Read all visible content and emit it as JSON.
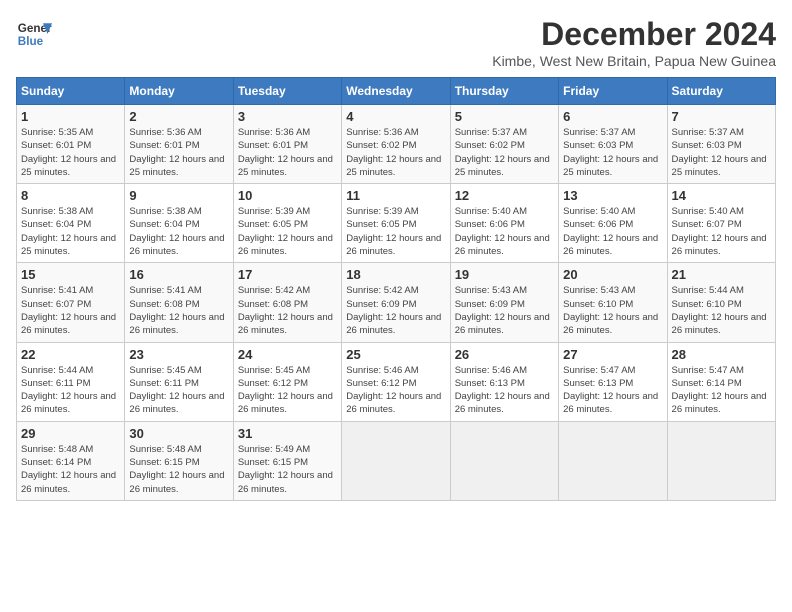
{
  "header": {
    "logo_line1": "General",
    "logo_line2": "Blue",
    "month_title": "December 2024",
    "subtitle": "Kimbe, West New Britain, Papua New Guinea"
  },
  "weekdays": [
    "Sunday",
    "Monday",
    "Tuesday",
    "Wednesday",
    "Thursday",
    "Friday",
    "Saturday"
  ],
  "weeks": [
    [
      {
        "day": "1",
        "sunrise": "5:35 AM",
        "sunset": "6:01 PM",
        "daylight": "12 hours and 25 minutes."
      },
      {
        "day": "2",
        "sunrise": "5:36 AM",
        "sunset": "6:01 PM",
        "daylight": "12 hours and 25 minutes."
      },
      {
        "day": "3",
        "sunrise": "5:36 AM",
        "sunset": "6:01 PM",
        "daylight": "12 hours and 25 minutes."
      },
      {
        "day": "4",
        "sunrise": "5:36 AM",
        "sunset": "6:02 PM",
        "daylight": "12 hours and 25 minutes."
      },
      {
        "day": "5",
        "sunrise": "5:37 AM",
        "sunset": "6:02 PM",
        "daylight": "12 hours and 25 minutes."
      },
      {
        "day": "6",
        "sunrise": "5:37 AM",
        "sunset": "6:03 PM",
        "daylight": "12 hours and 25 minutes."
      },
      {
        "day": "7",
        "sunrise": "5:37 AM",
        "sunset": "6:03 PM",
        "daylight": "12 hours and 25 minutes."
      }
    ],
    [
      {
        "day": "8",
        "sunrise": "5:38 AM",
        "sunset": "6:04 PM",
        "daylight": "12 hours and 25 minutes."
      },
      {
        "day": "9",
        "sunrise": "5:38 AM",
        "sunset": "6:04 PM",
        "daylight": "12 hours and 26 minutes."
      },
      {
        "day": "10",
        "sunrise": "5:39 AM",
        "sunset": "6:05 PM",
        "daylight": "12 hours and 26 minutes."
      },
      {
        "day": "11",
        "sunrise": "5:39 AM",
        "sunset": "6:05 PM",
        "daylight": "12 hours and 26 minutes."
      },
      {
        "day": "12",
        "sunrise": "5:40 AM",
        "sunset": "6:06 PM",
        "daylight": "12 hours and 26 minutes."
      },
      {
        "day": "13",
        "sunrise": "5:40 AM",
        "sunset": "6:06 PM",
        "daylight": "12 hours and 26 minutes."
      },
      {
        "day": "14",
        "sunrise": "5:40 AM",
        "sunset": "6:07 PM",
        "daylight": "12 hours and 26 minutes."
      }
    ],
    [
      {
        "day": "15",
        "sunrise": "5:41 AM",
        "sunset": "6:07 PM",
        "daylight": "12 hours and 26 minutes."
      },
      {
        "day": "16",
        "sunrise": "5:41 AM",
        "sunset": "6:08 PM",
        "daylight": "12 hours and 26 minutes."
      },
      {
        "day": "17",
        "sunrise": "5:42 AM",
        "sunset": "6:08 PM",
        "daylight": "12 hours and 26 minutes."
      },
      {
        "day": "18",
        "sunrise": "5:42 AM",
        "sunset": "6:09 PM",
        "daylight": "12 hours and 26 minutes."
      },
      {
        "day": "19",
        "sunrise": "5:43 AM",
        "sunset": "6:09 PM",
        "daylight": "12 hours and 26 minutes."
      },
      {
        "day": "20",
        "sunrise": "5:43 AM",
        "sunset": "6:10 PM",
        "daylight": "12 hours and 26 minutes."
      },
      {
        "day": "21",
        "sunrise": "5:44 AM",
        "sunset": "6:10 PM",
        "daylight": "12 hours and 26 minutes."
      }
    ],
    [
      {
        "day": "22",
        "sunrise": "5:44 AM",
        "sunset": "6:11 PM",
        "daylight": "12 hours and 26 minutes."
      },
      {
        "day": "23",
        "sunrise": "5:45 AM",
        "sunset": "6:11 PM",
        "daylight": "12 hours and 26 minutes."
      },
      {
        "day": "24",
        "sunrise": "5:45 AM",
        "sunset": "6:12 PM",
        "daylight": "12 hours and 26 minutes."
      },
      {
        "day": "25",
        "sunrise": "5:46 AM",
        "sunset": "6:12 PM",
        "daylight": "12 hours and 26 minutes."
      },
      {
        "day": "26",
        "sunrise": "5:46 AM",
        "sunset": "6:13 PM",
        "daylight": "12 hours and 26 minutes."
      },
      {
        "day": "27",
        "sunrise": "5:47 AM",
        "sunset": "6:13 PM",
        "daylight": "12 hours and 26 minutes."
      },
      {
        "day": "28",
        "sunrise": "5:47 AM",
        "sunset": "6:14 PM",
        "daylight": "12 hours and 26 minutes."
      }
    ],
    [
      {
        "day": "29",
        "sunrise": "5:48 AM",
        "sunset": "6:14 PM",
        "daylight": "12 hours and 26 minutes."
      },
      {
        "day": "30",
        "sunrise": "5:48 AM",
        "sunset": "6:15 PM",
        "daylight": "12 hours and 26 minutes."
      },
      {
        "day": "31",
        "sunrise": "5:49 AM",
        "sunset": "6:15 PM",
        "daylight": "12 hours and 26 minutes."
      },
      null,
      null,
      null,
      null
    ]
  ]
}
